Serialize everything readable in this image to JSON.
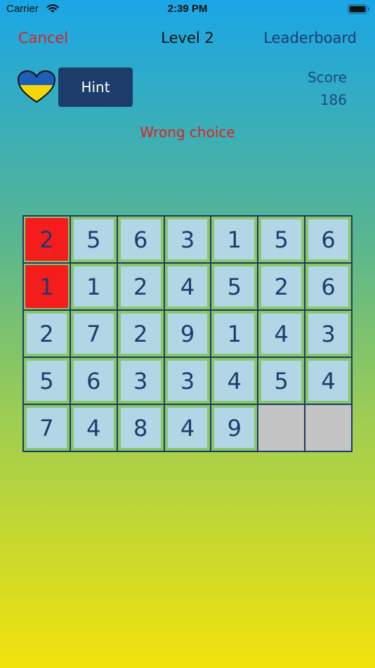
{
  "status_bar": {
    "carrier": "Carrier",
    "time": "2:39 PM"
  },
  "nav": {
    "cancel_label": "Cancel",
    "title": "Level 2",
    "leaderboard_label": "Leaderboard"
  },
  "hint_label": "Hint",
  "score": {
    "label": "Score",
    "value": "186"
  },
  "message": "Wrong choice",
  "colors": {
    "selected_tile": "#f51c1c",
    "tile": "#b2d6e6",
    "tile_border": "#86c96a",
    "empty_slot": "#c4c4c4",
    "grid_line": "#1f3a63",
    "hint_button": "#1c3d6a",
    "cancel": "#e02020",
    "heart_top": "#1d5fb8",
    "heart_bottom": "#f5d60a"
  },
  "grid": {
    "columns": 7,
    "rows": [
      [
        {
          "v": "2",
          "state": "selected"
        },
        {
          "v": "5",
          "state": "normal"
        },
        {
          "v": "6",
          "state": "normal"
        },
        {
          "v": "3",
          "state": "normal"
        },
        {
          "v": "1",
          "state": "normal"
        },
        {
          "v": "5",
          "state": "normal"
        },
        {
          "v": "6",
          "state": "normal"
        }
      ],
      [
        {
          "v": "1",
          "state": "selected"
        },
        {
          "v": "1",
          "state": "normal"
        },
        {
          "v": "2",
          "state": "normal"
        },
        {
          "v": "4",
          "state": "normal"
        },
        {
          "v": "5",
          "state": "normal"
        },
        {
          "v": "2",
          "state": "normal"
        },
        {
          "v": "6",
          "state": "normal"
        }
      ],
      [
        {
          "v": "2",
          "state": "normal"
        },
        {
          "v": "7",
          "state": "normal"
        },
        {
          "v": "2",
          "state": "normal"
        },
        {
          "v": "9",
          "state": "normal"
        },
        {
          "v": "1",
          "state": "normal"
        },
        {
          "v": "4",
          "state": "normal"
        },
        {
          "v": "3",
          "state": "normal"
        }
      ],
      [
        {
          "v": "5",
          "state": "normal"
        },
        {
          "v": "6",
          "state": "normal"
        },
        {
          "v": "3",
          "state": "normal"
        },
        {
          "v": "3",
          "state": "normal"
        },
        {
          "v": "4",
          "state": "normal"
        },
        {
          "v": "5",
          "state": "normal"
        },
        {
          "v": "4",
          "state": "normal"
        }
      ],
      [
        {
          "v": "7",
          "state": "normal"
        },
        {
          "v": "4",
          "state": "normal"
        },
        {
          "v": "8",
          "state": "normal"
        },
        {
          "v": "4",
          "state": "normal"
        },
        {
          "v": "9",
          "state": "normal"
        },
        {
          "v": "",
          "state": "empty"
        },
        {
          "v": "",
          "state": "empty"
        }
      ]
    ]
  }
}
